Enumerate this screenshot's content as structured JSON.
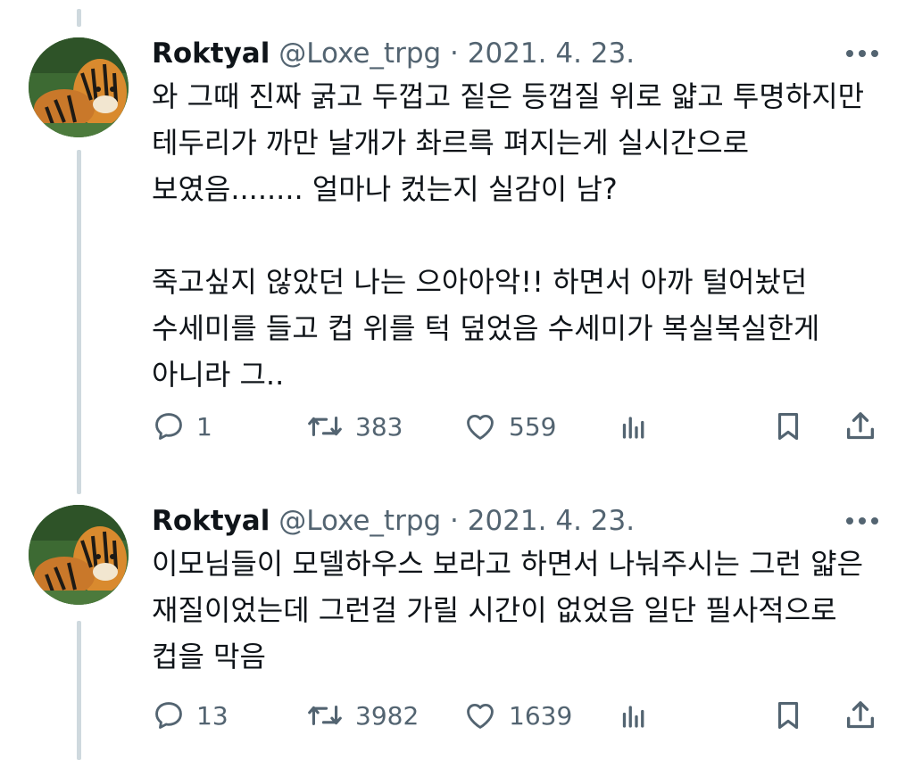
{
  "tweets": [
    {
      "author": "Roktyal",
      "handle": "@Loxe_trpg",
      "separator": "·",
      "date": "2021. 4. 23.",
      "paragraphs": [
        "와 그때 진짜 굵고 두껍고 짙은 등껍질 위로 얇고 투명하지만 테두리가 까만 날개가 촤르륵 펴지는게 실시간으로 보였음........ 얼마나 컸는지 실감이 남?",
        "죽고싶지 않았던 나는 으아아악!! 하면서 아까 털어놨던 수세미를 들고 컵 위를 턱 덮었음 수세미가 복실복실한게 아니라 그.."
      ],
      "replies": "1",
      "retweets": "383",
      "likes": "559"
    },
    {
      "author": "Roktyal",
      "handle": "@Loxe_trpg",
      "separator": "·",
      "date": "2021. 4. 23.",
      "paragraphs": [
        "이모님들이 모델하우스 보라고 하면서 나눠주시는 그런 얇은 재질이었는데 그런걸 가릴 시간이 없었음 일단 필사적으로 컵을 막음"
      ],
      "replies": "13",
      "retweets": "3982",
      "likes": "1639"
    }
  ],
  "icons": {
    "reply": "speech-bubble-icon",
    "retweet": "retweet-arrows-icon",
    "like": "heart-icon",
    "views": "bar-chart-icon",
    "bookmark": "bookmark-icon",
    "share": "share-upload-icon",
    "more": "ellipsis-icon"
  },
  "colors": {
    "text": "#0f1419",
    "secondary": "#536471",
    "thread_line": "#cfd9de"
  }
}
